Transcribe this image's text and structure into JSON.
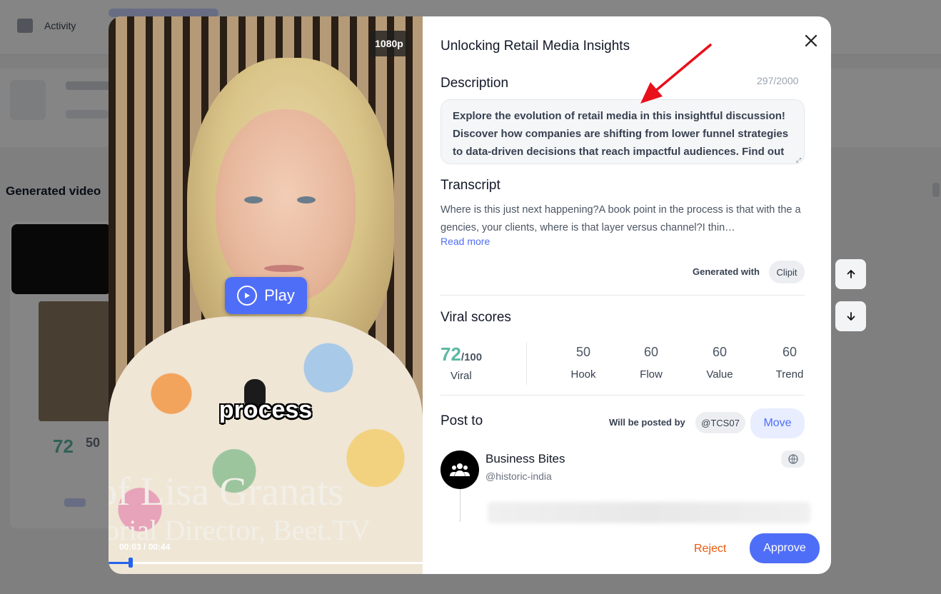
{
  "background": {
    "nav_activity": "Activity",
    "section_title": "Generated video",
    "score_value": "72",
    "score_value_2": "50"
  },
  "video": {
    "resolution_badge": "1080p",
    "play_label": "Play",
    "caption_word": "process",
    "lower_third_name": "of Lisa Granats",
    "lower_third_title": "torial Director, Beet.TV",
    "time": "00:03 / 00:44",
    "progress_fraction": 0.07
  },
  "details": {
    "title": "Unlocking Retail Media Insights",
    "description_heading": "Description",
    "char_count": "297/2000",
    "description_text": "Explore the evolution of retail media in this insightful discussion! Discover how companies are shifting from lower funnel strategies to data-driven decisions that reach impactful audiences. Find out more about retail media trends and insights.",
    "transcript_heading": "Transcript",
    "transcript_text": "Where is this just next happening?A book point in the process is that with the agencies, your clients, where is that layer versus channel?I thin…",
    "read_more": "Read more",
    "generated_with_label": "Generated with",
    "generated_with_tool": "Clipit"
  },
  "viral": {
    "heading": "Viral scores",
    "score": "72",
    "score_max": "/100",
    "score_label": "Viral",
    "metrics": [
      {
        "value": "50",
        "label": "Hook"
      },
      {
        "value": "60",
        "label": "Flow"
      },
      {
        "value": "60",
        "label": "Value"
      },
      {
        "value": "60",
        "label": "Trend"
      }
    ]
  },
  "post": {
    "heading": "Post to",
    "posted_by_label": "Will be posted by",
    "handle": "@TCS07",
    "move_label": "Move",
    "account_name": "Business Bites",
    "account_handle": "@historic-india"
  },
  "actions": {
    "reject": "Reject",
    "approve": "Approve"
  },
  "colors": {
    "accent": "#4f6ef7",
    "score_green": "#5eb8a5",
    "reject_orange": "#ea580c",
    "annotation_red": "#e8101a"
  }
}
